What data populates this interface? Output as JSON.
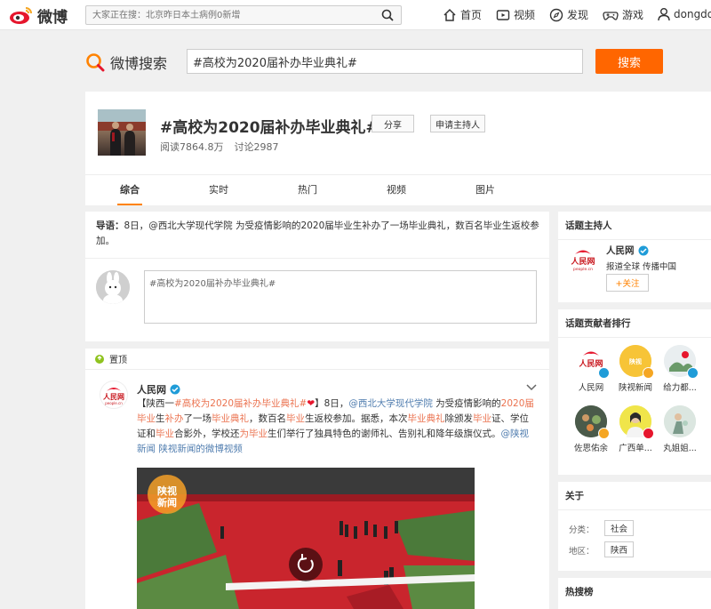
{
  "topbar": {
    "brand": "微博",
    "search_placeholder": "大家正在搜：北京昨日本土病例0新增",
    "nav": {
      "home": "首页",
      "video": "视频",
      "discover": "发现",
      "game": "游戏",
      "user": "dongdon"
    }
  },
  "search": {
    "brand": "微博搜索",
    "query": "#高校为2020届补办毕业典礼#",
    "button": "搜索"
  },
  "topic": {
    "title": "#高校为2020届补办毕业典礼#",
    "share": "分享",
    "apply_host": "申请主持人",
    "reads": "阅读7864.8万",
    "discussions": "讨论2987"
  },
  "tabs": [
    "综合",
    "实时",
    "热门",
    "视频",
    "图片"
  ],
  "intro": {
    "label": "导语：",
    "text_before": "8日，",
    "mention": "@西北大学现代学院",
    "text_after": " 为受疫情影响的2020届毕业生补办了一场毕业典礼，数百名毕业生返校参加。"
  },
  "composer": {
    "value": "#高校为2020届补办毕业典礼#"
  },
  "pinned": {
    "label": "置顶"
  },
  "post": {
    "author": "人民网",
    "p1": "【陕西一",
    "p2": "#高校为2020届补办毕业典礼#",
    "p3": "❤",
    "p4": "】8日，",
    "p5": "@西北大学现代学院",
    "p6": " 为受疫情影响的",
    "p7": "2020届毕业",
    "p8": "生",
    "p9": "补办",
    "p10": "了一场",
    "p11": "毕业典礼",
    "p12": "，数百名",
    "p13": "毕业",
    "p14": "生返校参加。据悉，本次",
    "p15": "毕业典礼",
    "p16": "除颁发",
    "p17": "毕业",
    "p18": "证、学位证和",
    "p19": "毕业",
    "p20": "合影外，学校还",
    "p21": "为",
    "p22": "毕业",
    "p23": "生们举行了独具特色的谢师礼、告别礼和降年级旗仪式。",
    "p24": "@陕视新闻",
    "p25": " 陕视新闻的微博视频",
    "video_watermark": "陕视新闻"
  },
  "sidebar": {
    "host_title": "话题主持人",
    "host_name": "人民网",
    "host_desc": "报道全球 传播中国",
    "follow": "+关注",
    "contrib_title": "话题贡献者排行",
    "contributors": [
      "人民网",
      "陕视新闻",
      "给力都...",
      "佐思佑余",
      "广西单...",
      "丸姐姐..."
    ],
    "about_title": "关于",
    "category_label": "分类：",
    "category": "社会",
    "region_label": "地区：",
    "region": "陕西",
    "hot_title": "热搜榜"
  },
  "colors": {
    "accent": "#ff8200",
    "search_button": "#ff6600",
    "highlight": "#eb7350",
    "link": "#507daf"
  }
}
